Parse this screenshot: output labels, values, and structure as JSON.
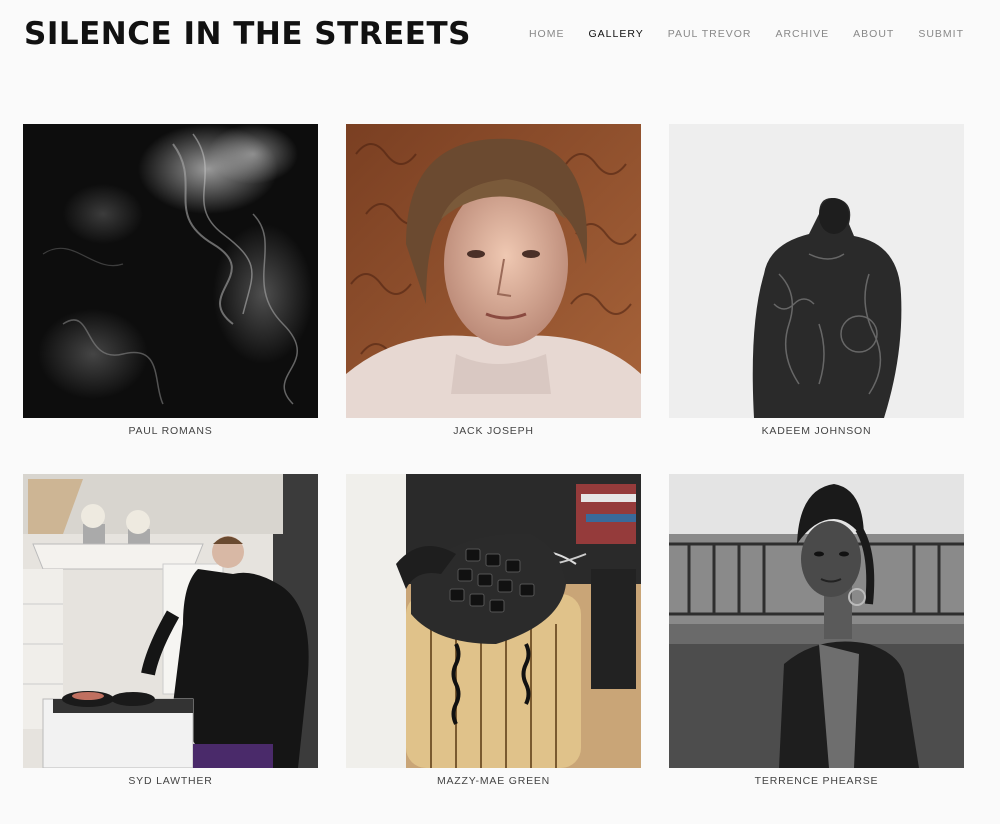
{
  "site": {
    "title": "SILENCE IN THE STREETS"
  },
  "nav": [
    {
      "label": "HOME",
      "active": false
    },
    {
      "label": "GALLERY",
      "active": true
    },
    {
      "label": "PAUL TREVOR",
      "active": false
    },
    {
      "label": "ARCHIVE",
      "active": false
    },
    {
      "label": "ABOUT",
      "active": false
    },
    {
      "label": "SUBMIT",
      "active": false
    }
  ],
  "gallery": [
    {
      "name": "PAUL ROMANS",
      "photo": "smoke-photo"
    },
    {
      "name": "JACK JOSEPH",
      "photo": "portrait-photo"
    },
    {
      "name": "KADEEM JOHNSON",
      "photo": "back-tattoo-photo"
    },
    {
      "name": "SYD LAWTHER",
      "photo": "kitchen-photo"
    },
    {
      "name": "MAZZY-MAE GREEN",
      "photo": "telephone-photo"
    },
    {
      "name": "TERRENCE PHEARSE",
      "photo": "durag-portrait-photo"
    }
  ]
}
